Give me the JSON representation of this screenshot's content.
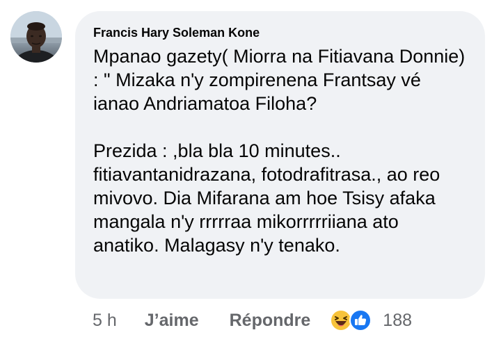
{
  "comment": {
    "author": "Francis Hary Soleman Kone",
    "text": "Mpanao gazety( Miorra na Fitiavana Donnie) : \" Mizaka n'y zompirenena Frantsay vé ianao Andriamatoa Filoha?\n\nPrezida : ,bla bla 10 minutes.. fitiavantanidrazana, fotodrafitrasa., ao reo mivovo. Dia  Mifarana am hoe  Tsisy afaka mangala n'y rrrrraa mikorrrrriiana ato anatiko. Malagasy n'y tenako.",
    "time": "5 h",
    "like_label": "J’aime",
    "reply_label": "Répondre",
    "reaction_count": "188",
    "reaction_icons": [
      "haha-icon",
      "like-icon"
    ]
  },
  "colors": {
    "bubble": "#f0f2f5",
    "text": "#050505",
    "meta": "#65676b",
    "like_blue": "#1877f2",
    "haha_yellow": "#f7c33b"
  }
}
